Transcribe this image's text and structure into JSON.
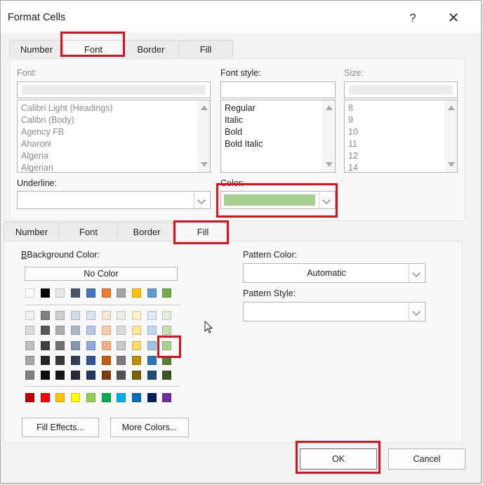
{
  "dialog": {
    "title": "Format Cells",
    "help_label": "?",
    "close_label": "✕"
  },
  "top_tabs": [
    "Number",
    "Font",
    "Border",
    "Fill"
  ],
  "font_panel": {
    "font_label": "Font:",
    "font_list": [
      "Calibri Light (Headings)",
      "Calibri (Body)",
      "Agency FB",
      "Aharoni",
      "Algeria",
      "Algerian"
    ],
    "style_label": "Font style:",
    "style_list": [
      "Regular",
      "Italic",
      "Bold",
      "Bold Italic"
    ],
    "size_label": "Size:",
    "size_list": [
      "8",
      "9",
      "10",
      "11",
      "12",
      "14"
    ],
    "underline_label": "Underline:",
    "color_label": "Color:",
    "color_value": "#a9d18e"
  },
  "bottom_tabs": [
    "Number",
    "Font",
    "Border",
    "Fill"
  ],
  "fill_panel": {
    "bg_color_label": "Background Color:",
    "no_color_label": "No Color",
    "theme_row": [
      "#ffffff",
      "#000000",
      "#e7e6e6",
      "#44546a",
      "#4472c4",
      "#ed7d31",
      "#a5a5a5",
      "#ffc000",
      "#5b9bd5",
      "#70ad47"
    ],
    "tint_rows": [
      [
        "#f2f2f2",
        "#808080",
        "#d0cece",
        "#d6dce4",
        "#d9e2f3",
        "#fbe5d6",
        "#ededed",
        "#fff2cc",
        "#deebf7",
        "#e2f0d9"
      ],
      [
        "#d9d9d9",
        "#595959",
        "#aeabab",
        "#adb9ca",
        "#b4c7e7",
        "#f8cbad",
        "#dbdbdb",
        "#ffe699",
        "#bdd7ee",
        "#c5e0b4"
      ],
      [
        "#bfbfbf",
        "#404040",
        "#757171",
        "#8497b0",
        "#8faadc",
        "#f4b183",
        "#c9c9c9",
        "#ffd966",
        "#9dc3e6",
        "#a9d18e"
      ],
      [
        "#a6a6a6",
        "#262626",
        "#3b3838",
        "#333f50",
        "#2f5597",
        "#c55a11",
        "#7b7b7b",
        "#bf9000",
        "#2e75b6",
        "#548235"
      ],
      [
        "#808080",
        "#0d0d0d",
        "#171616",
        "#222a35",
        "#203864",
        "#843c0c",
        "#525252",
        "#7f6000",
        "#1f4e79",
        "#385723"
      ]
    ],
    "standard_row": [
      "#c00000",
      "#ff0000",
      "#ffc000",
      "#ffff00",
      "#92d050",
      "#00b050",
      "#00b0f0",
      "#0070c0",
      "#002060",
      "#7030a0"
    ],
    "fill_effects_label": "Fill Effects...",
    "more_colors_label": "More Colors...",
    "pattern_color_label": "Pattern Color:",
    "pattern_color_value": "Automatic",
    "pattern_style_label": "Pattern Style:"
  },
  "footer": {
    "ok_label": "OK",
    "cancel_label": "Cancel"
  },
  "highlight_color": "#e0101a"
}
